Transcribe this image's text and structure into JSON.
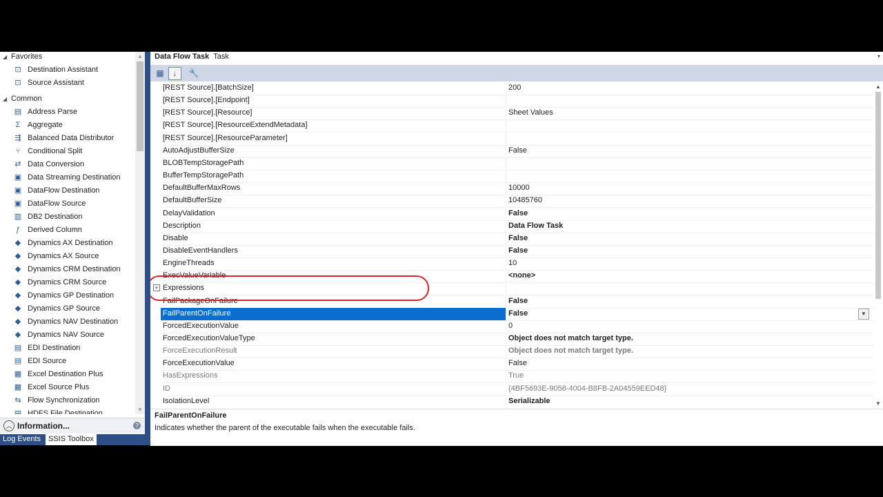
{
  "toolbox": {
    "groups": [
      {
        "label": "Favorites",
        "items": [
          {
            "label": "Destination Assistant",
            "icon": "destination-assistant-icon"
          },
          {
            "label": "Source Assistant",
            "icon": "source-assistant-icon"
          }
        ]
      },
      {
        "label": "Common",
        "items": [
          {
            "label": "Address Parse",
            "icon": "address-parse-icon"
          },
          {
            "label": "Aggregate",
            "icon": "aggregate-icon"
          },
          {
            "label": "Balanced Data Distributor",
            "icon": "distributor-icon"
          },
          {
            "label": "Conditional Split",
            "icon": "split-icon"
          },
          {
            "label": "Data Conversion",
            "icon": "conversion-icon"
          },
          {
            "label": "Data Streaming Destination",
            "icon": "streaming-icon"
          },
          {
            "label": "DataFlow Destination",
            "icon": "dataflow-destination-icon"
          },
          {
            "label": "DataFlow Source",
            "icon": "dataflow-source-icon"
          },
          {
            "label": "DB2 Destination",
            "icon": "db2-icon"
          },
          {
            "label": "Derived Column",
            "icon": "derived-column-icon"
          },
          {
            "label": "Dynamics AX Destination",
            "icon": "dynamics-icon"
          },
          {
            "label": "Dynamics AX Source",
            "icon": "dynamics-icon"
          },
          {
            "label": "Dynamics CRM Destination",
            "icon": "dynamics-icon"
          },
          {
            "label": "Dynamics CRM Source",
            "icon": "dynamics-icon"
          },
          {
            "label": "Dynamics GP Destination",
            "icon": "dynamics-icon"
          },
          {
            "label": "Dynamics GP Source",
            "icon": "dynamics-icon"
          },
          {
            "label": "Dynamics NAV Destination",
            "icon": "dynamics-icon"
          },
          {
            "label": "Dynamics NAV Source",
            "icon": "dynamics-icon"
          },
          {
            "label": "EDI Destination",
            "icon": "edi-icon"
          },
          {
            "label": "EDI Source",
            "icon": "edi-icon"
          },
          {
            "label": "Excel Destination Plus",
            "icon": "excel-icon"
          },
          {
            "label": "Excel Source Plus",
            "icon": "excel-icon"
          },
          {
            "label": "Flow Synchronization",
            "icon": "sync-icon"
          },
          {
            "label": "HDFS File Destination",
            "icon": "hdfs-icon"
          }
        ]
      }
    ],
    "info_label": "Information...",
    "bottom_tabs": [
      "Log Events",
      "SSIS Toolbox"
    ]
  },
  "properties": {
    "title": "Data Flow Task",
    "subtitle": "Task",
    "rows": [
      {
        "name": "[REST Source].[BatchSize]",
        "value": "200",
        "style": "normal"
      },
      {
        "name": "[REST Source].[Endpoint]",
        "value": "",
        "style": "normal"
      },
      {
        "name": "[REST Source].[Resource]",
        "value": "Sheet Values",
        "style": "normal"
      },
      {
        "name": "[REST Source].[ResourceExtendMetadata]",
        "value": "",
        "style": "normal"
      },
      {
        "name": "[REST Source].[ResourceParameter]",
        "value": "",
        "style": "normal"
      },
      {
        "name": "AutoAdjustBufferSize",
        "value": "False",
        "style": "normal"
      },
      {
        "name": "BLOBTempStoragePath",
        "value": "",
        "style": "normal"
      },
      {
        "name": "BufferTempStoragePath",
        "value": "",
        "style": "normal"
      },
      {
        "name": "DefaultBufferMaxRows",
        "value": "10000",
        "style": "normal"
      },
      {
        "name": "DefaultBufferSize",
        "value": "10485760",
        "style": "normal"
      },
      {
        "name": "DelayValidation",
        "value": "False",
        "style": "bold"
      },
      {
        "name": "Description",
        "value": "Data Flow Task",
        "style": "bold"
      },
      {
        "name": "Disable",
        "value": "False",
        "style": "bold"
      },
      {
        "name": "DisableEventHandlers",
        "value": "False",
        "style": "bold"
      },
      {
        "name": "EngineThreads",
        "value": "10",
        "style": "normal"
      },
      {
        "name": "ExecValueVariable",
        "value": "<none>",
        "style": "bold"
      },
      {
        "name": "Expressions",
        "value": "",
        "style": "expandable"
      },
      {
        "name": "FailPackageOnFailure",
        "value": "False",
        "style": "bold"
      },
      {
        "name": "FailParentOnFailure",
        "value": "False",
        "style": "selected"
      },
      {
        "name": "ForcedExecutionValue",
        "value": "0",
        "style": "normal"
      },
      {
        "name": "ForcedExecutionValueType",
        "value": "Object does not match target type.",
        "style": "bold"
      },
      {
        "name": "ForceExecutionResult",
        "value": "Object does not match target type.",
        "style": "greybold"
      },
      {
        "name": "ForceExecutionValue",
        "value": "False",
        "style": "normal"
      },
      {
        "name": "HasExpressions",
        "value": "True",
        "style": "grey"
      },
      {
        "name": "ID",
        "value": "{4BF5693E-9058-4004-B8FB-2A04559EED48}",
        "style": "grey"
      },
      {
        "name": "IsolationLevel",
        "value": "Serializable",
        "style": "bold"
      }
    ],
    "description_title": "FailParentOnFailure",
    "description_text": "Indicates whether the parent of the executable fails when the executable fails."
  },
  "colors": {
    "selection": "#0a6ed1",
    "accent": "#2d4f85",
    "highlight_ring": "#d2252a"
  }
}
